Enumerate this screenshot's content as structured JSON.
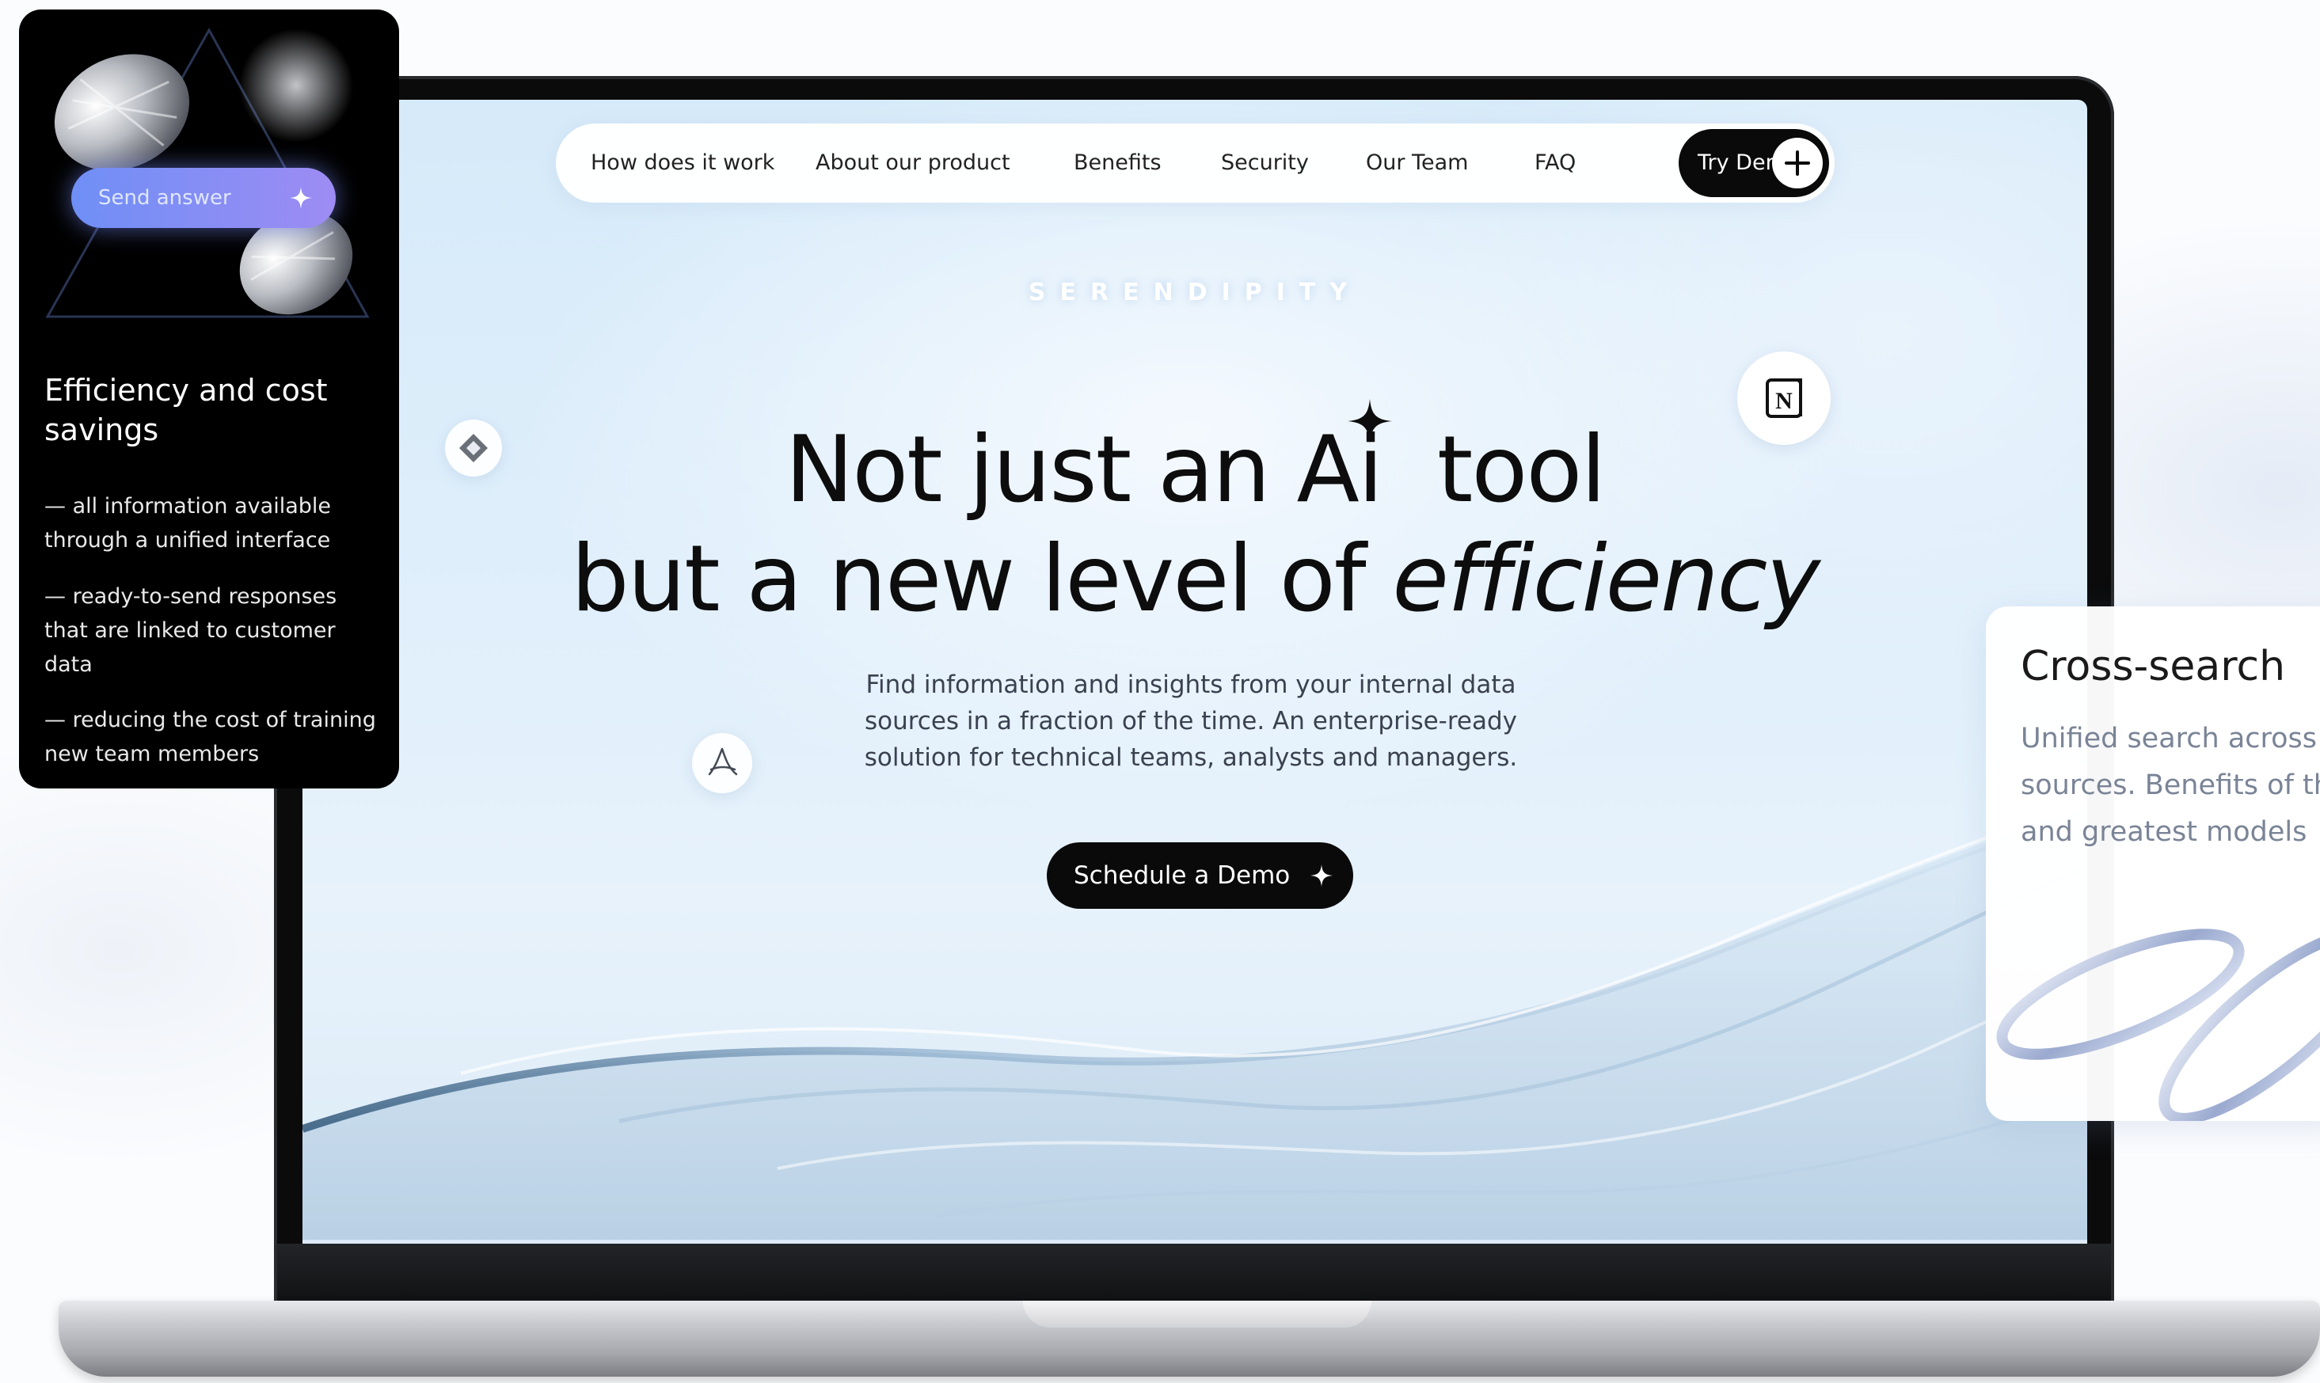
{
  "nav": {
    "items": [
      "How does it work",
      "About our product",
      "Benefits",
      "Security",
      "Our Team",
      "FAQ"
    ],
    "cta_label": "Try Demo"
  },
  "hero": {
    "brand": "SERENDIPITY",
    "headline_line1_a": "Not just an Ai",
    "headline_line1_b": "tool",
    "headline_line2_a": "but a new level of",
    "headline_line2_b": "efficiency",
    "subtext": "Find information and insights from your internal data sources in a fraction of the time. An enterprise-ready solution for technical teams, analysts and managers.",
    "cta_label": "Schedule a Demo"
  },
  "floating_icons": [
    "notion-icon",
    "gem-icon",
    "pdf-icon"
  ],
  "left_card": {
    "button_label": "Send answer",
    "title": "Efficiency and cost savings",
    "bullets": [
      "— all information available through a unified interface",
      "— ready-to-send responses that are linked to customer data",
      "— reducing the cost of training new team members"
    ]
  },
  "right_card": {
    "title": "Cross-search",
    "body": "Unified search across sources. Benefits of the and greatest models"
  },
  "colors": {
    "cta": "#0a0a0a",
    "screen_blue": "#d6eaf9",
    "card_dark": "#000000",
    "send_gradient_start": "#6f8ff6",
    "send_gradient_end": "#9d8cf3"
  }
}
